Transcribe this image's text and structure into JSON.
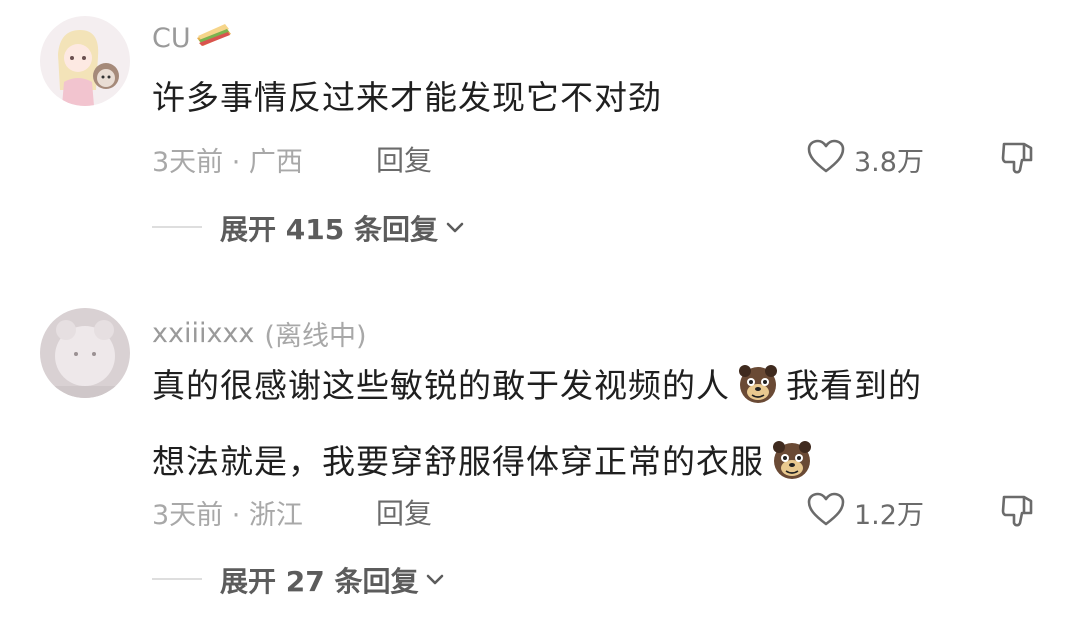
{
  "comments": [
    {
      "username": "CU",
      "username_emoji": "sandwich-icon",
      "status": "",
      "text_lines": [
        "许多事情反过来才能发现它不对劲"
      ],
      "time": "3天前",
      "location": "广西",
      "meta": "3天前 · 广西",
      "reply_label": "回复",
      "likes": "3.8万",
      "expand_label": "展开 415 条回复"
    },
    {
      "username": "xxiiixxx",
      "status": "(离线中)",
      "text_lines": [
        "真的很感谢这些敏锐的敢于发视频的人",
        "我看到的",
        "想法就是，我要穿舒服得体穿正常的衣服"
      ],
      "time": "3天前",
      "location": "浙江",
      "meta": "3天前 · 浙江",
      "reply_label": "回复",
      "likes": "1.2万",
      "expand_label": "展开 27 条回复"
    }
  ],
  "icons": {
    "like": "heart-outline-icon",
    "dislike": "thumbs-down-icon",
    "expand": "chevron-down-icon",
    "emoji": "dog-face-emoji"
  },
  "colors": {
    "text_primary": "#1f1f1f",
    "text_secondary": "#a8a8a8",
    "action": "#6b6b6b"
  }
}
